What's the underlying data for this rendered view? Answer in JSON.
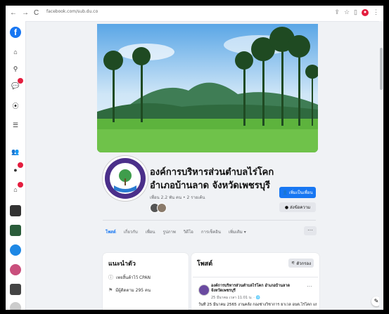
{
  "browser": {
    "url": "facebook.com/sub.du.co",
    "nav": {
      "back": "←",
      "forward": "→",
      "reload": "C"
    }
  },
  "page": {
    "title_line1": "องค์การบริหารส่วนตำบลไร่โคก",
    "title_line2": "อำเภอบ้านลาด จังหวัดเพชรบุรี",
    "meta": "เพื่อน 2.2 พัน คน • 2 รายเค้น",
    "primary_button": "เพิ่มเป็นเพื่อน",
    "secondary_button": "ส่งข้อความ",
    "tabs": [
      "โพสต์",
      "เกี่ยวกับ",
      "เพื่อน",
      "รูปภาพ",
      "วิดีโอ",
      "การเช็คอิน",
      "เพิ่มเติม ▾"
    ],
    "more_button": "···"
  },
  "intro": {
    "title": "แนะนำตัว",
    "rows": [
      {
        "icon": "info-icon",
        "text": "เพจสิ้นค้าไว้ CPAN"
      },
      {
        "icon": "followers-icon",
        "text": "มีผู้ติดตาม 295 คน"
      }
    ]
  },
  "posts": {
    "title": "โพสต์",
    "filter_button": "ตัวกรอง",
    "post": {
      "author": "องค์การบริหารส่วนตำบลไร่โคก อำเภอบ้านลาด จังหวัดเพชรบุรี",
      "time": "25 มีนาคม เวลา 11:01 น. · 🌐",
      "text": "วันที่ 25 มีนาคม 2565 งานคลัง กองช่างวิชาการ ยาเวล อบต.ไร่โคก แบบลงทะเบียนโครง"
    }
  },
  "colors": {
    "brand": "#1877f2",
    "alert": "#e41e3f"
  }
}
